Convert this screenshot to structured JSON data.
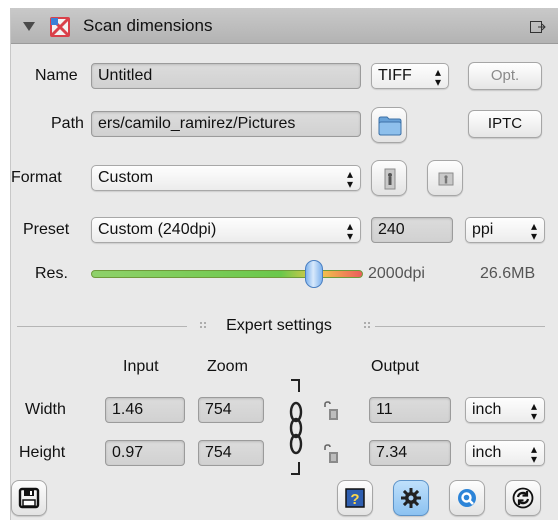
{
  "header": {
    "title": "Scan dimensions"
  },
  "name_row": {
    "label": "Name",
    "value": "Untitled",
    "type_select": "TIFF",
    "options_button": "Opt."
  },
  "path_row": {
    "label": "Path",
    "value": "ers/camilo_ramirez/Pictures",
    "iptc_button": "IPTC"
  },
  "format_row": {
    "label": "Format",
    "value": "Custom"
  },
  "preset_row": {
    "label": "Preset",
    "value": "Custom (240dpi)",
    "ppi_value": "240",
    "unit_select": "ppi"
  },
  "res_row": {
    "label": "Res.",
    "dpi_text": "2000dpi",
    "size_text": "26.6MB",
    "slider_fraction": 0.82
  },
  "expert": {
    "title": "Expert settings",
    "col_input": "Input",
    "col_zoom": "Zoom",
    "col_output": "Output",
    "width": {
      "label": "Width",
      "input": "1.46",
      "zoom": "754",
      "output": "11",
      "unit": "inch"
    },
    "height": {
      "label": "Height",
      "input": "0.97",
      "zoom": "754",
      "output": "7.34",
      "unit": "inch"
    }
  },
  "colors": {
    "accent_blue": "#3c8fe0",
    "panel_bg": "#e9e9e9",
    "header_bg": "#bdbdbd"
  },
  "icons": [
    "disclosure-triangle-icon",
    "app-icon",
    "detach-icon",
    "folder-icon",
    "portrait-icon",
    "landscape-icon",
    "link-chain-icon",
    "lock-icon",
    "save-icon",
    "help-icon",
    "gear-icon",
    "quick-icon",
    "refresh-icon"
  ]
}
